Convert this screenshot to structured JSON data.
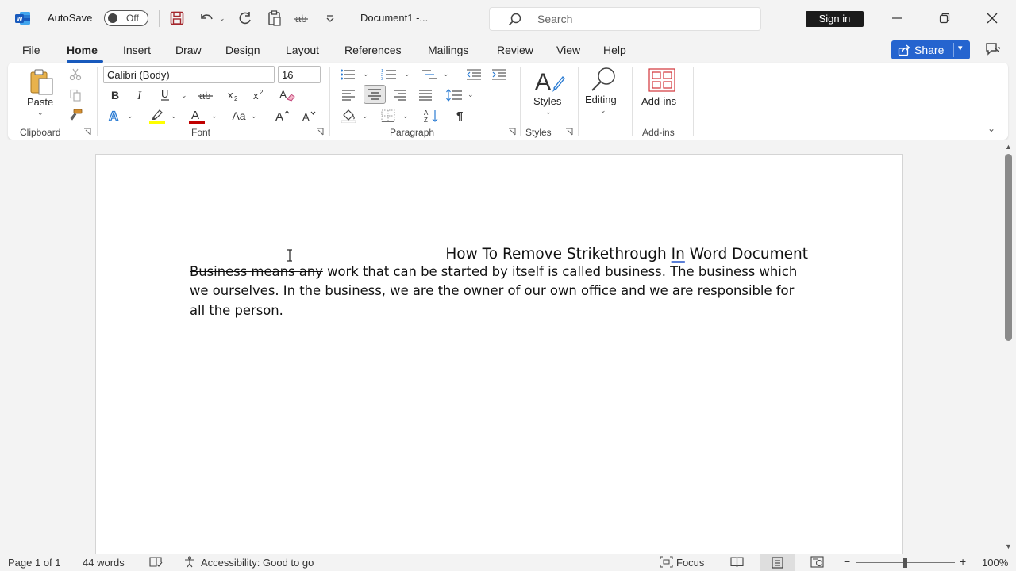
{
  "titlebar": {
    "autosave_label": "AutoSave",
    "autosave_state": "Off",
    "document_title": "Document1  -...",
    "search_placeholder": "Search",
    "signin_label": "Sign in"
  },
  "tabs": [
    {
      "label": "File"
    },
    {
      "label": "Home"
    },
    {
      "label": "Insert"
    },
    {
      "label": "Draw"
    },
    {
      "label": "Design"
    },
    {
      "label": "Layout"
    },
    {
      "label": "References"
    },
    {
      "label": "Mailings"
    },
    {
      "label": "Review"
    },
    {
      "label": "View"
    },
    {
      "label": "Help"
    }
  ],
  "share_label": "Share",
  "ribbon": {
    "clipboard": {
      "paste_label": "Paste",
      "group_label": "Clipboard"
    },
    "font": {
      "font_name": "Calibri (Body)",
      "font_size": "16",
      "group_label": "Font",
      "change_case_label": "Aa"
    },
    "paragraph": {
      "group_label": "Paragraph"
    },
    "styles": {
      "button_label": "Styles",
      "group_label": "Styles"
    },
    "editing": {
      "button_label": "Editing"
    },
    "addins": {
      "button_label": "Add-ins",
      "group_label": "Add-ins"
    }
  },
  "document": {
    "heading_pre": "How To Remove Strikethrough ",
    "heading_in": "In",
    "heading_post": " Word Document",
    "strike_text": "Business means any",
    "body_text": " work that can be started by itself is called business. The business which we ourselves. In the business, we are the owner of our own office and we are responsible for all the person."
  },
  "statusbar": {
    "page": "Page 1 of 1",
    "words": "44 words",
    "accessibility": "Accessibility: Good to go",
    "focus": "Focus",
    "zoom": "100%"
  },
  "colors": {
    "accent": "#185abd",
    "share_button": "#2564cf",
    "highlight_yellow": "#ffff00",
    "font_color_red": "#c00000",
    "addins_red": "#d13438"
  }
}
